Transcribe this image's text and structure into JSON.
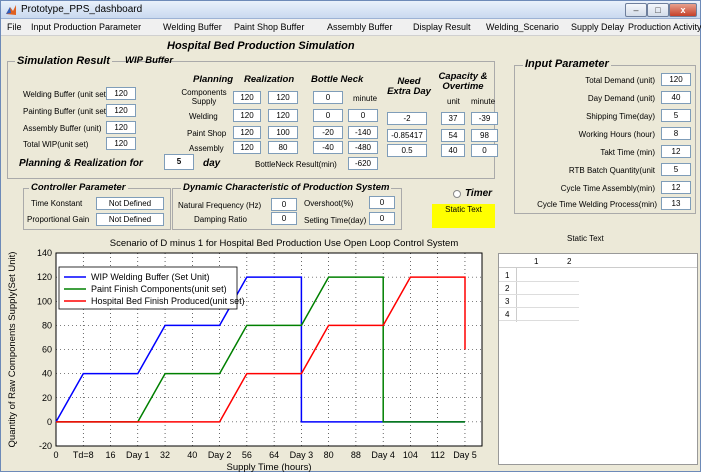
{
  "window": {
    "title": "Prototype_PPS_dashboard",
    "min": "–",
    "max": "□",
    "close": "x"
  },
  "menu": [
    "File",
    "Input Production Parameter",
    "Welding Buffer",
    "Paint Shop Buffer",
    "Assembly Buffer",
    "Display Result",
    "Welding_Scenario",
    "Supply Delay",
    "Production Activity"
  ],
  "header": {
    "title": "Hospital Bed Production Simulation"
  },
  "sim_result": {
    "title": "Simulation Result",
    "wip_title": "WIP Buffer",
    "wip_rows": [
      {
        "label": "Welding Buffer (unit set)",
        "value": "120"
      },
      {
        "label": "Painting  Buffer (unit set)",
        "value": "120"
      },
      {
        "label": "Assembly  Buffer (unit)",
        "value": "120"
      },
      {
        "label": "Total WIP(unit set)",
        "value": "120"
      }
    ],
    "col_planning": "Planning",
    "col_realization": "Realization",
    "col_bottleneck": "Bottle Neck",
    "minute": "minute",
    "need_extra": "Need\nExtra Day",
    "capacity": "Capacity &\nOvertime",
    "cap_unit": "unit",
    "cap_minute": "minute",
    "rows": [
      {
        "label": "Components\nSupply",
        "planning": "120",
        "realization": "120",
        "bn": "0",
        "bn_min": "",
        "extra": "",
        "cap": "",
        "cap_min": ""
      },
      {
        "label": "Welding",
        "planning": "120",
        "realization": "120",
        "bn": "0",
        "bn_min": "0",
        "extra": "-2",
        "cap": "37",
        "cap_min": "-39"
      },
      {
        "label": "Paint Shop",
        "planning": "120",
        "realization": "100",
        "bn": "-20",
        "bn_min": "-140",
        "extra": "-0.85417",
        "cap": "54",
        "cap_min": "98"
      },
      {
        "label": "Assembly",
        "planning": "120",
        "realization": "80",
        "bn": "-40",
        "bn_min": "-480",
        "extra": "0.5",
        "cap": "40",
        "cap_min": "0"
      }
    ],
    "bn_result_label": "BottleNeck Result(min)",
    "bn_result": "-620",
    "pr_label": "Planning  & Realization for",
    "pr_days": "5",
    "pr_day": "day"
  },
  "input_param": {
    "title": "Input Parameter",
    "rows": [
      {
        "label": "Total Demand (unit)",
        "value": "120"
      },
      {
        "label": "Day Demand (unit)",
        "value": "40"
      },
      {
        "label": "Shipping Time(day)",
        "value": "5"
      },
      {
        "label": "Working Hours (hour)",
        "value": "8"
      },
      {
        "label": "Takt Time (min)",
        "value": "12"
      },
      {
        "label": "RTB Batch Quantity(unit",
        "value": "5"
      },
      {
        "label": "Cycle Time Assembly(min)",
        "value": "12"
      },
      {
        "label": "Cycle Time Welding Process(min)",
        "value": "13"
      }
    ]
  },
  "controller": {
    "title": "Controller Parameter",
    "rows": [
      {
        "label": "Time Konstant",
        "value": "Not Defined"
      },
      {
        "label": "Proportional Gain",
        "value": "Not Defined"
      }
    ]
  },
  "dynamic": {
    "title": "Dynamic Characteristic of  Production System",
    "rows": [
      {
        "label": "Natural Frequency (Hz)",
        "value": "0",
        "label2": "Overshoot(%)",
        "value2": "0"
      },
      {
        "label": "Damping Ratio",
        "value": "0",
        "label2": "Setling Time(day)",
        "value2": "0"
      }
    ]
  },
  "timer": {
    "label": "Timer",
    "static": "Static Text"
  },
  "static_text_2": "Static Text",
  "table": {
    "columns": [
      "1",
      "2"
    ],
    "rows": [
      "1",
      "2",
      "3",
      "4"
    ]
  },
  "colors": {
    "wip": "#0000ff",
    "paint": "#008000",
    "hospital": "#ff0000",
    "accent_yellow": "#ffff00"
  },
  "chart_data": {
    "type": "line",
    "title": "Scenario of D minus 1 for Hospital Bed Production Use Open Loop Control System",
    "xlabel": "Supply Time (hours)",
    "ylabel": "Quantity of Raw Components Supply(Set Unit)",
    "xlim": [
      0,
      125
    ],
    "ylim": [
      -20,
      140
    ],
    "xticks": [
      {
        "v": 0,
        "l": "0"
      },
      {
        "v": 8,
        "l": "Td=8"
      },
      {
        "v": 16,
        "l": "16"
      },
      {
        "v": 24,
        "l": "Day 1"
      },
      {
        "v": 32,
        "l": "32"
      },
      {
        "v": 40,
        "l": "40"
      },
      {
        "v": 48,
        "l": "Day 2"
      },
      {
        "v": 56,
        "l": "56"
      },
      {
        "v": 64,
        "l": "64"
      },
      {
        "v": 72,
        "l": "Day 3"
      },
      {
        "v": 80,
        "l": "80"
      },
      {
        "v": 88,
        "l": "88"
      },
      {
        "v": 96,
        "l": "Day 4"
      },
      {
        "v": 104,
        "l": "104"
      },
      {
        "v": 112,
        "l": "112"
      },
      {
        "v": 120,
        "l": "Day 5"
      }
    ],
    "yticks": [
      -20,
      0,
      20,
      40,
      60,
      80,
      100,
      120,
      140
    ],
    "grid": true,
    "legend": "top-left",
    "series": [
      {
        "name": "WIP  Welding Buffer (Set Unit)",
        "color": "#0000ff",
        "points": [
          [
            0,
            0
          ],
          [
            8,
            40
          ],
          [
            24,
            40
          ],
          [
            32,
            80
          ],
          [
            48,
            80
          ],
          [
            56,
            120
          ],
          [
            72,
            120
          ],
          [
            72,
            0
          ],
          [
            120,
            0
          ]
        ]
      },
      {
        "name": "Paint Finish Components(unit set)",
        "color": "#008000",
        "points": [
          [
            0,
            0
          ],
          [
            24,
            0
          ],
          [
            32,
            40
          ],
          [
            48,
            40
          ],
          [
            56,
            80
          ],
          [
            72,
            80
          ],
          [
            80,
            120
          ],
          [
            96,
            120
          ],
          [
            96,
            0
          ],
          [
            120,
            0
          ]
        ]
      },
      {
        "name": "Hospital Bed Finish Produced(unit set)",
        "color": "#ff0000",
        "points": [
          [
            0,
            0
          ],
          [
            48,
            0
          ],
          [
            56,
            40
          ],
          [
            72,
            40
          ],
          [
            80,
            80
          ],
          [
            96,
            80
          ],
          [
            104,
            120
          ],
          [
            120,
            120
          ],
          [
            120,
            60
          ]
        ]
      }
    ]
  }
}
